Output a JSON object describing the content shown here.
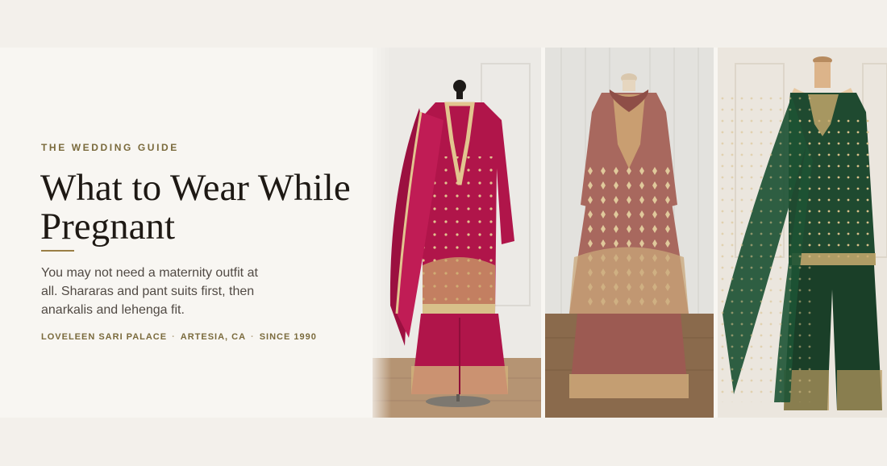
{
  "hero": {
    "eyebrow": "THE WEDDING GUIDE",
    "title": "What to Wear While Pregnant",
    "description": "You may not need a maternity outfit at all. Shararas and pant suits first, then anarkalis and lehenga fit.",
    "meta": {
      "store": "LOVELEEN SARI PALACE",
      "location": "ARTESIA, CA",
      "since": "SINCE 1990",
      "separator": "·"
    }
  },
  "photos": [
    {
      "outfit": "magenta sharara suit with dupatta",
      "color": "#b0154a"
    },
    {
      "outfit": "dusty rose anarkali with embroidered dupatta",
      "color": "#a8685e"
    },
    {
      "outfit": "bottle green palazzo suit with net dupatta",
      "color": "#1f4a30"
    }
  ],
  "colors": {
    "background": "#f3f0eb",
    "panel": "#f8f6f2",
    "accent": "#9a7f46",
    "embroidery": "#d8c08a"
  }
}
